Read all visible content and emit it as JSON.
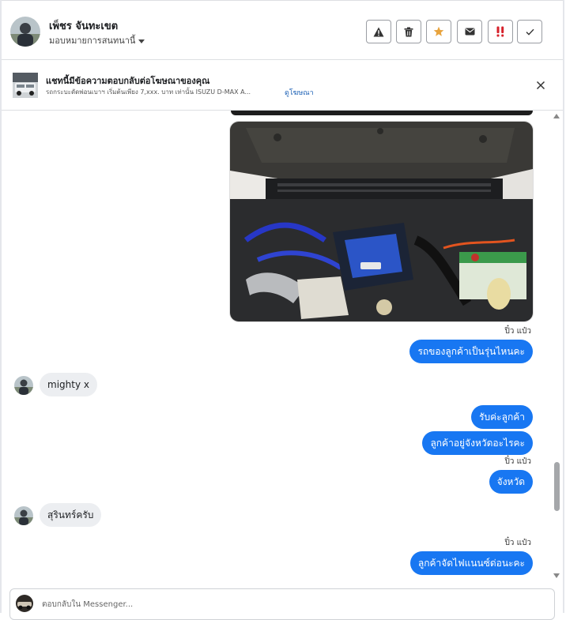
{
  "header": {
    "contact_name": "เพ็ชร จันทะเขต",
    "assign_label": "มอบหมายการสนทนานี้",
    "actions": [
      {
        "icon": "warning-icon",
        "label": "Report"
      },
      {
        "icon": "trash-icon",
        "label": "Delete"
      },
      {
        "icon": "star-icon",
        "label": "Star"
      },
      {
        "icon": "mail-icon",
        "label": "Mark unread"
      },
      {
        "icon": "important-icon",
        "label": "Important"
      },
      {
        "icon": "check-icon",
        "label": "Done"
      }
    ],
    "colors": {
      "star": "#e8a33d",
      "important": "#d6202a"
    }
  },
  "ad": {
    "title": "แชทนี้มีข้อความตอบกลับต่อโฆษณาของคุณ",
    "description": "รถกระบะดัดพ่อนเบาฯ เริ่มต้นเพียง 7,xxx. บาท เท่านั้น ISUZU D-MAX A...",
    "link": "ดูโฆษณา"
  },
  "messages": {
    "ts1": "ปิ๋ว แป๋ว",
    "out1": "รถของลูกค้าเป็นรุ่นไหนคะ",
    "in1": "mighty x",
    "out2": "รับค่ะลูกค้า",
    "out3": "ลูกค้าอยู่จังหวัดอะไรคะ",
    "ts2": "ปิ๋ว แป๋ว",
    "out4": "จังหวัด",
    "in2": "สุรินทร์ครับ",
    "ts3": "ปิ๋ว แป๋ว",
    "out5": "ลูกค้าจัดไฟแนนซ์ด่อนะคะ"
  },
  "composer": {
    "placeholder": "ตอบกลับใน Messenger..."
  },
  "colors": {
    "accent": "#1877f2",
    "incoming": "#eceef1"
  }
}
